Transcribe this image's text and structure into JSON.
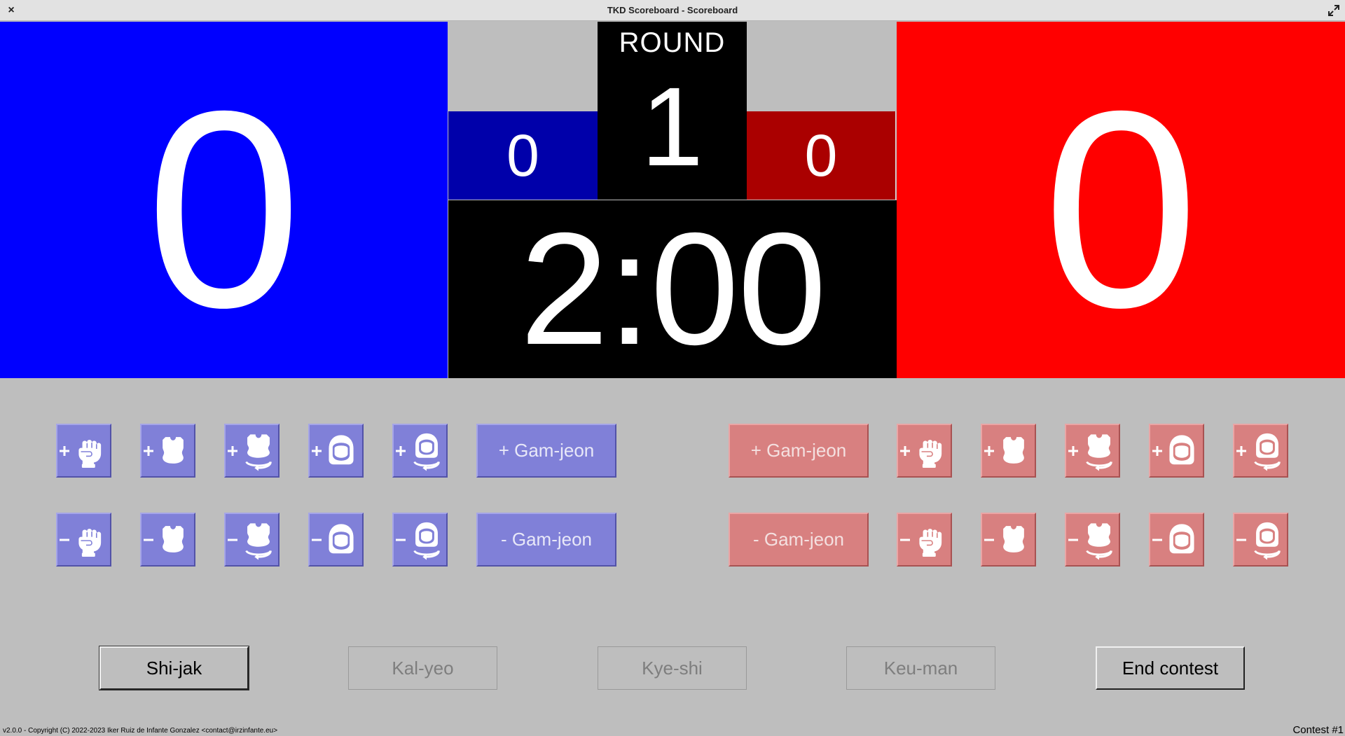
{
  "window": {
    "title": "TKD Scoreboard - Scoreboard"
  },
  "scoreboard": {
    "blue_score": "0",
    "red_score": "0",
    "round_label": "ROUND",
    "round_number": "1",
    "blue_gamjeon": "0",
    "red_gamjeon": "0",
    "timer": "2:00"
  },
  "colors": {
    "blue": "#0000ff",
    "red": "#ff0000",
    "blue_dark": "#0000aa",
    "red_dark": "#aa0000",
    "blue_button": "#8080d8",
    "red_button": "#d88080",
    "background": "#bebebe"
  },
  "actions": {
    "plus_gamjeon": "+ Gam-jeon",
    "minus_gamjeon": "- Gam-jeon",
    "icons": [
      "punch-icon",
      "body-protector-icon",
      "body-turning-kick-icon",
      "head-icon",
      "head-turning-kick-icon"
    ]
  },
  "controls": {
    "shijak": "Shi-jak",
    "kalyeo": "Kal-yeo",
    "kyeshi": "Kye-shi",
    "keuman": "Keu-man",
    "end_contest": "End contest"
  },
  "footer": {
    "copyright": "v2.0.0 - Copyright (C) 2022-2023 Iker Ruiz de Infante Gonzalez <contact@irzinfante.eu>",
    "contest": "Contest #1"
  }
}
